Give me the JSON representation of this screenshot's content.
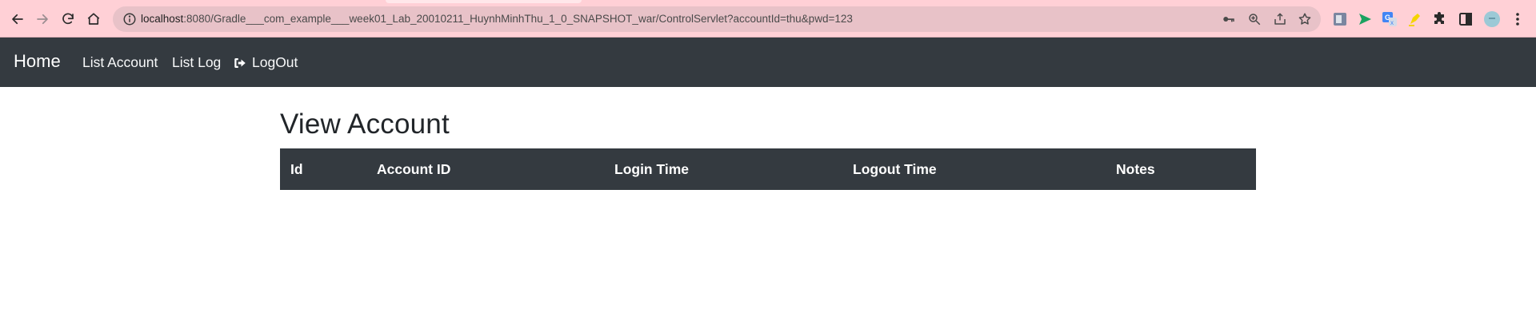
{
  "browser": {
    "url_host": "localhost",
    "url_rest": ":8080/Gradle___com_example___week01_Lab_20010211_HuynhMinhThu_1_0_SNAPSHOT_war/ControlServlet?accountId=thu&pwd=123",
    "nav": {
      "back": "back-arrow-icon",
      "forward": "forward-arrow-icon",
      "reload": "reload-icon",
      "home": "home-icon"
    },
    "omnibox_icons": [
      "key-icon",
      "zoom-icon",
      "share-icon",
      "star-icon"
    ],
    "extensions": [
      "page-capture-icon",
      "send-icon",
      "translate-icon",
      "highlighter-icon",
      "puzzle-icon",
      "sidepanel-icon",
      "profile-avatar",
      "kebab-menu-icon"
    ]
  },
  "navbar": {
    "brand": "Home",
    "links": [
      "List Account",
      "List Log"
    ],
    "logout_label": "LogOut",
    "bg_color": "#343a40"
  },
  "main": {
    "title": "View Account",
    "table": {
      "headers": [
        "Id",
        "Account ID",
        "Login Time",
        "Logout Time",
        "Notes"
      ],
      "rows": []
    }
  }
}
